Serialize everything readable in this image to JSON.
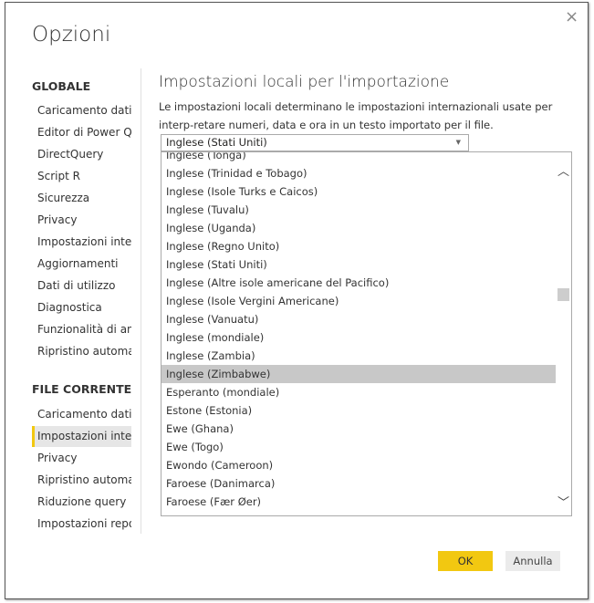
{
  "dialog": {
    "title": "Opzioni",
    "close_icon": "×"
  },
  "sidebar": {
    "global_header": "GLOBALE",
    "global_items": [
      {
        "label": "Caricamento dati"
      },
      {
        "label": "Editor di Power Qu"
      },
      {
        "label": "DirectQuery"
      },
      {
        "label": "Script R"
      },
      {
        "label": "Sicurezza"
      },
      {
        "label": "Privacy"
      },
      {
        "label": "Impostazioni intern"
      },
      {
        "label": "Aggiornamenti"
      },
      {
        "label": "Dati di utilizzo"
      },
      {
        "label": "Diagnostica"
      },
      {
        "label": "Funzionalità di ante"
      },
      {
        "label": "Ripristino automati"
      }
    ],
    "file_header": "FILE CORRENTE",
    "file_items": [
      {
        "label": "Caricamento dati"
      },
      {
        "label": "Impostazioni intern",
        "selected": true
      },
      {
        "label": "Privacy"
      },
      {
        "label": "Ripristino automati"
      },
      {
        "label": "Riduzione query"
      },
      {
        "label": "Impostazioni repor"
      }
    ]
  },
  "main": {
    "heading": "Impostazioni locali per l'importazione",
    "description": "Le impostazioni locali determinano le impostazioni internazionali usate per interp-retare numeri, data e ora in un testo importato per il file.",
    "select_value": "Inglese (Stati Uniti)",
    "options": [
      "Inglese (Tonga)",
      "Inglese (Trinidad e Tobago)",
      "Inglese (Isole Turks e Caicos)",
      "Inglese (Tuvalu)",
      "Inglese (Uganda)",
      "Inglese (Regno Unito)",
      "Inglese (Stati Uniti)",
      "Inglese (Altre isole americane del Pacifico)",
      "Inglese (Isole Vergini Americane)",
      "Inglese (Vanuatu)",
      "Inglese (mondiale)",
      "Inglese (Zambia)",
      "Inglese (Zimbabwe)",
      "Esperanto (mondiale)",
      "Estone (Estonia)",
      "Ewe (Ghana)",
      "Ewe (Togo)",
      "Ewondo (Cameroon)",
      "Faroese (Danimarca)",
      "Faroese (Fær Øer)"
    ],
    "highlighted_option": "Inglese (Zimbabwe)"
  },
  "footer": {
    "ok_label": "OK",
    "cancel_label": "Annulla"
  },
  "colors": {
    "accent": "#f2c811",
    "highlight": "#c8c8c8"
  }
}
